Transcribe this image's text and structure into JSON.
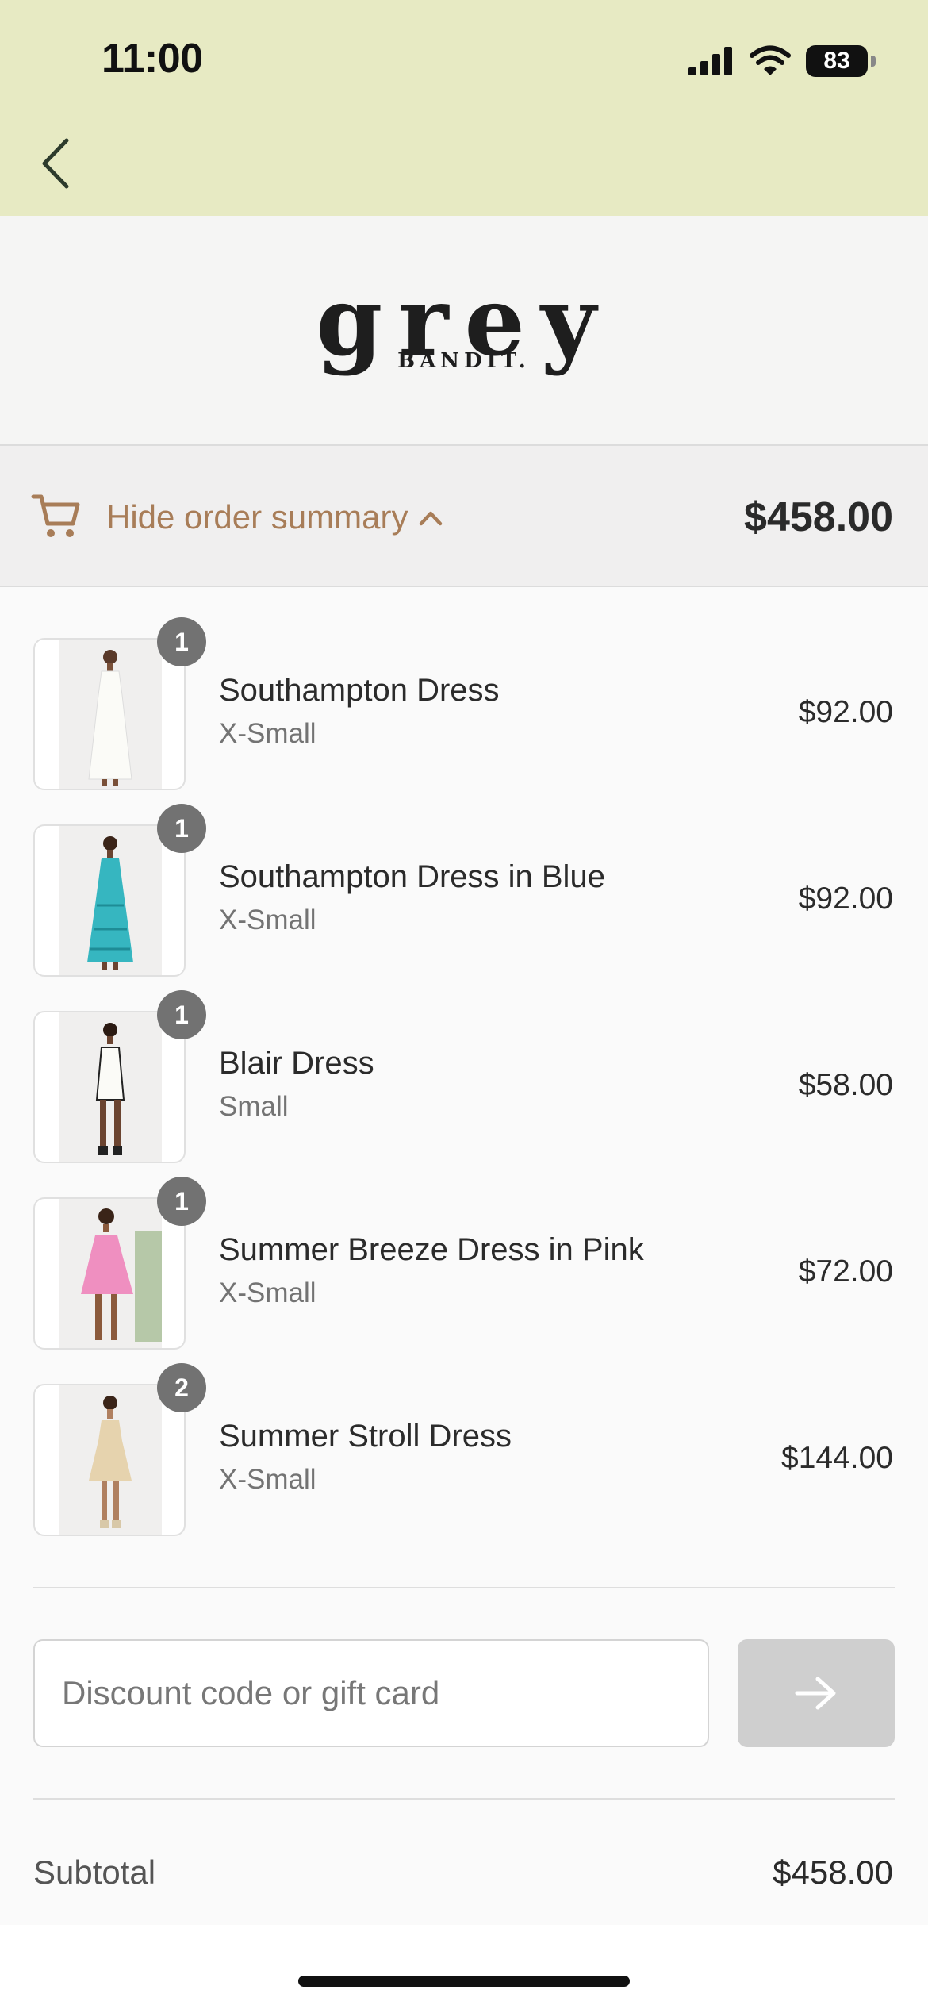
{
  "status_bar": {
    "time": "11:00",
    "battery": "83"
  },
  "brand": {
    "logo_main": "grey",
    "logo_sub": "BANDIT."
  },
  "summary": {
    "toggle_label": "Hide order summary",
    "total": "$458.00"
  },
  "items": [
    {
      "name": "Southampton Dress",
      "variant": "X-Small",
      "price": "$92.00",
      "qty": "1",
      "photo_color": "#f4f2ee",
      "dress_color": "#fbfbf7"
    },
    {
      "name": "Southampton Dress in Blue",
      "variant": "X-Small",
      "price": "$92.00",
      "qty": "1",
      "photo_color": "#f4f2ee",
      "dress_color": "#36b6c0"
    },
    {
      "name": "Blair Dress",
      "variant": "Small",
      "price": "$58.00",
      "qty": "1",
      "photo_color": "#f4f2ee",
      "dress_color": "#fbfbf7"
    },
    {
      "name": "Summer Breeze Dress in Pink",
      "variant": "X-Small",
      "price": "$72.00",
      "qty": "1",
      "photo_color": "#f4f2ee",
      "dress_color": "#ef8fc0"
    },
    {
      "name": "Summer Stroll Dress",
      "variant": "X-Small",
      "price": "$144.00",
      "qty": "2",
      "photo_color": "#f4f2ee",
      "dress_color": "#e6d3ae"
    }
  ],
  "discount": {
    "placeholder": "Discount code or gift card"
  },
  "totals": {
    "subtotal_label": "Subtotal",
    "subtotal_value": "$458.00"
  },
  "colors": {
    "status_bg": "#e7eac3",
    "accent": "#a87d58"
  }
}
